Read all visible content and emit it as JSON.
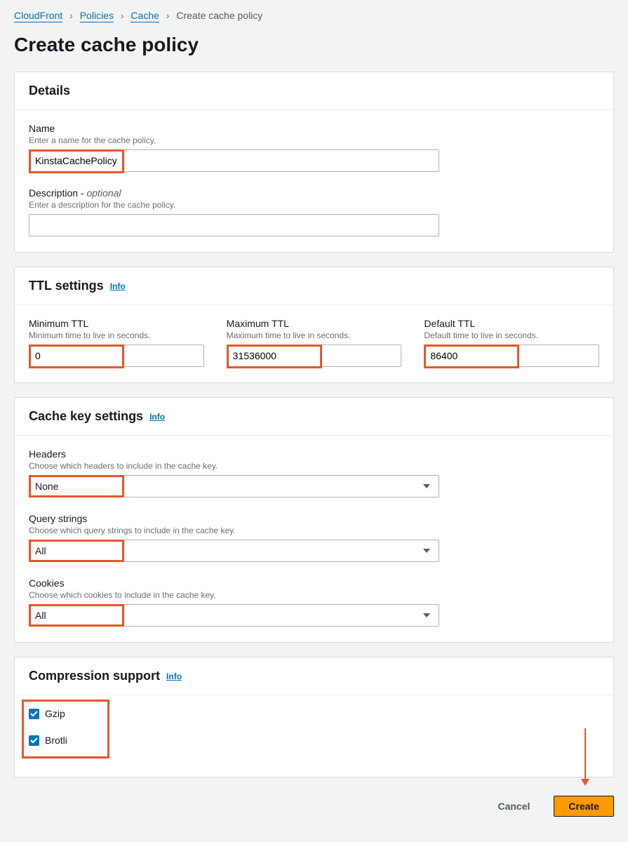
{
  "breadcrumb": {
    "items": [
      "CloudFront",
      "Policies",
      "Cache"
    ],
    "current": "Create cache policy"
  },
  "page_title": "Create cache policy",
  "details": {
    "header": "Details",
    "name_label": "Name",
    "name_desc": "Enter a name for the cache policy.",
    "name_value": "KinstaCachePolicy",
    "desc_label": "Description - ",
    "desc_optional": "optional",
    "desc_desc": "Enter a description for the cache policy.",
    "desc_value": ""
  },
  "ttl": {
    "header": "TTL settings",
    "info": "Info",
    "min_label": "Minimum TTL",
    "min_desc": "Minimum time to live in seconds.",
    "min_value": "0",
    "max_label": "Maximum TTL",
    "max_desc": "Maximum time to live in seconds.",
    "max_value": "31536000",
    "def_label": "Default TTL",
    "def_desc": "Default time to live in seconds.",
    "def_value": "86400"
  },
  "cachekey": {
    "header": "Cache key settings",
    "info": "Info",
    "headers_label": "Headers",
    "headers_desc": "Choose which headers to include in the cache key.",
    "headers_value": "None",
    "qs_label": "Query strings",
    "qs_desc": "Choose which query strings to include in the cache key.",
    "qs_value": "All",
    "cookies_label": "Cookies",
    "cookies_desc": "Choose which cookies to include in the cache key.",
    "cookies_value": "All"
  },
  "compression": {
    "header": "Compression support",
    "info": "Info",
    "gzip_label": "Gzip",
    "gzip_checked": true,
    "brotli_label": "Brotli",
    "brotli_checked": true
  },
  "actions": {
    "cancel": "Cancel",
    "create": "Create"
  }
}
